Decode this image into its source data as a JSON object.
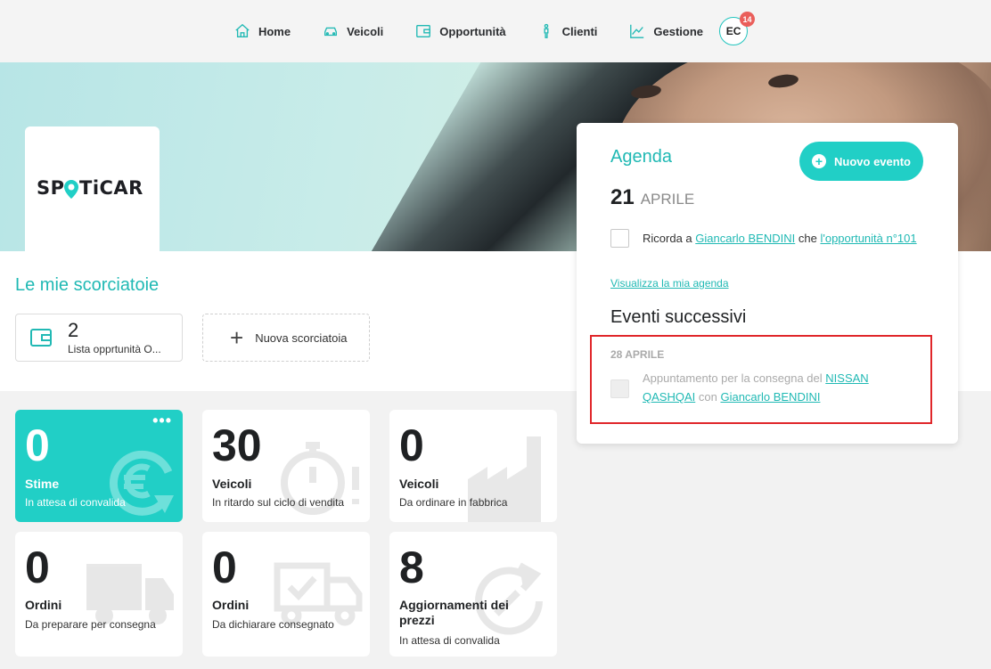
{
  "nav": {
    "items": [
      {
        "label": "Home",
        "icon": "home-icon"
      },
      {
        "label": "Veicoli",
        "icon": "car-icon"
      },
      {
        "label": "Opportunità",
        "icon": "wallet-icon"
      },
      {
        "label": "Clienti",
        "icon": "person-icon"
      },
      {
        "label": "Gestione",
        "icon": "chart-icon"
      }
    ],
    "avatar": {
      "initials": "EC",
      "badge": "14"
    }
  },
  "brand": {
    "logo_text": "SPOTiCAR"
  },
  "shortcuts": {
    "title": "Le mie scorciatoie",
    "items": [
      {
        "count": "2",
        "label": "Lista opprtunità O..."
      }
    ],
    "new_label": "Nuova scorciatoia"
  },
  "kpis": [
    {
      "value": "0",
      "title": "Stime",
      "subtitle": "In attesa di convalida",
      "icon": "euro-cycle-icon",
      "highlighted": true
    },
    {
      "value": "30",
      "title": "Veicoli",
      "subtitle": "In ritardo sul ciclo di vendita",
      "icon": "stopwatch-icon"
    },
    {
      "value": "0",
      "title": "Veicoli",
      "subtitle": "Da ordinare in fabbrica",
      "icon": "factory-icon"
    },
    {
      "value": "0",
      "title": "Ordini",
      "subtitle": "Da preparare per consegna",
      "icon": "truck-icon"
    },
    {
      "value": "0",
      "title": "Ordini",
      "subtitle": "Da dichiarare consegnato",
      "icon": "truck-check-icon"
    },
    {
      "value": "8",
      "title": "Aggiornamenti dei prezzi",
      "subtitle": "In attesa di convalida",
      "icon": "price-update-icon"
    }
  ],
  "agenda": {
    "title": "Agenda",
    "new_event": "Nuovo evento",
    "day": "21",
    "month": "APRILE",
    "event": {
      "prefix": "Ricorda a",
      "person": "Giancarlo BENDINI",
      "middle": "che",
      "link": "l'opportunità n°101"
    },
    "view_link": "Visualizza la mia agenda",
    "next_title": "Eventi successivi",
    "next_date": "28 APRILE",
    "next_event": {
      "prefix": "Appuntamento per la consegna del",
      "vehicle": "NISSAN QASHQAI",
      "middle": "con",
      "person": "Giancarlo BENDINI"
    }
  },
  "colors": {
    "accent": "#21cfc6",
    "accent_text": "#20b9b4",
    "badge": "#ea5f5b",
    "highlight_border": "#e0262a"
  }
}
